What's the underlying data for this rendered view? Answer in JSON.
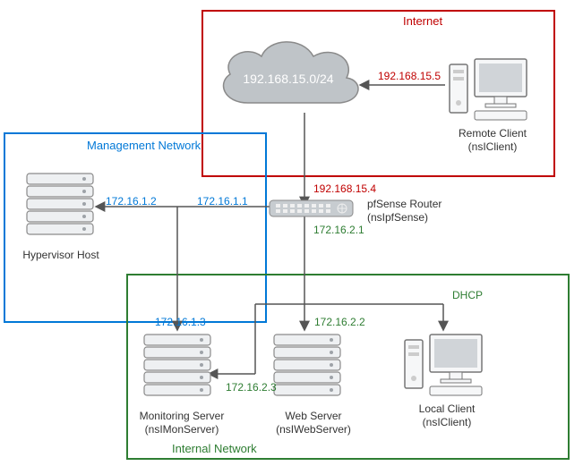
{
  "zones": {
    "internet": {
      "title": "Internet",
      "color": "#c00000"
    },
    "mgmt": {
      "title": "Management Network",
      "color": "#0078d7"
    },
    "internal": {
      "title": "Internal Network",
      "color": "#2e7d32"
    }
  },
  "cloud": {
    "text": "192.168.15.0/24"
  },
  "nodes": {
    "remoteClient": {
      "line1": "Remote Client",
      "line2": "(nsIClient)"
    },
    "router": {
      "line1": "pfSense Router",
      "line2": "(nsIpfSense)"
    },
    "hypervisor": {
      "line1": "Hypervisor Host"
    },
    "monServer": {
      "line1": "Monitoring Server",
      "line2": "(nsIMonServer)"
    },
    "webServer": {
      "line1": "Web Server",
      "line2": "(nsIWebServer)"
    },
    "localClient": {
      "line1": "Local Client",
      "line2": "(nsIClient)"
    }
  },
  "ips": {
    "remoteToCloud": "192.168.15.5",
    "cloudToRouter": "192.168.15.4",
    "routerMgmt": "172.16.1.1",
    "routerInternal": "172.16.2.1",
    "hypervisor": "172.16.1.2",
    "monServer": "172.16.1.3",
    "webServer": "172.16.2.2",
    "monServerInternal": "172.16.2.3",
    "localClientDhcp": "DHCP"
  },
  "colors": {
    "red": "#c00000",
    "blue": "#0078d7",
    "green": "#2e7d32",
    "gray": "#8a8a8a",
    "darkgray": "#555555"
  }
}
